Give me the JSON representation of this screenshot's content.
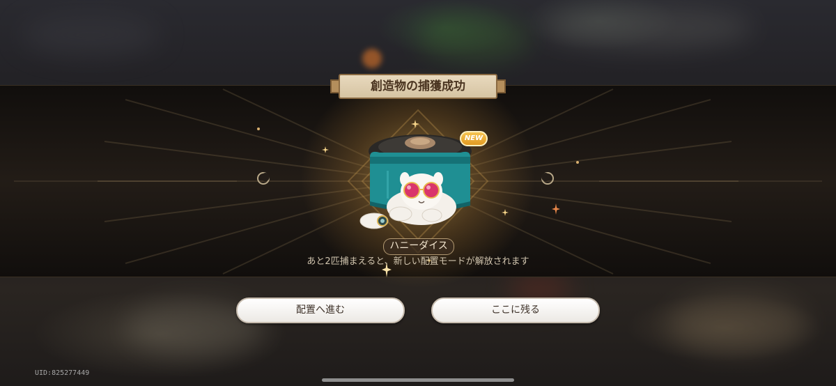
{
  "title": "創造物の捕獲成功",
  "creature": {
    "name": "ハニーダイス",
    "badge": "NEW"
  },
  "message": "あと2匹捕まえると、新しい配置モードが解放されます",
  "buttons": {
    "deploy": "配置へ進む",
    "stay": "ここに残る"
  },
  "uid": "UID:825277449",
  "colors": {
    "accent": "#e19a22",
    "plaque": "#d6c4a3",
    "creature_band": "#1f8f93"
  }
}
